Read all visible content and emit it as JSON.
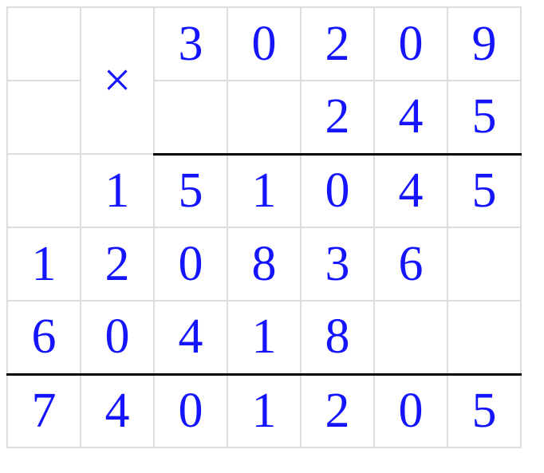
{
  "operator": "×",
  "multiplicand": [
    "3",
    "0",
    "2",
    "0",
    "9"
  ],
  "multiplier": [
    "",
    "",
    "2",
    "4",
    "5"
  ],
  "partials": [
    [
      "",
      "1",
      "5",
      "1",
      "0",
      "4",
      "5"
    ],
    [
      "1",
      "2",
      "0",
      "8",
      "3",
      "6",
      ""
    ],
    [
      "6",
      "0",
      "4",
      "1",
      "8",
      "",
      ""
    ]
  ],
  "result": [
    "7",
    "4",
    "0",
    "1",
    "2",
    "0",
    "5"
  ]
}
